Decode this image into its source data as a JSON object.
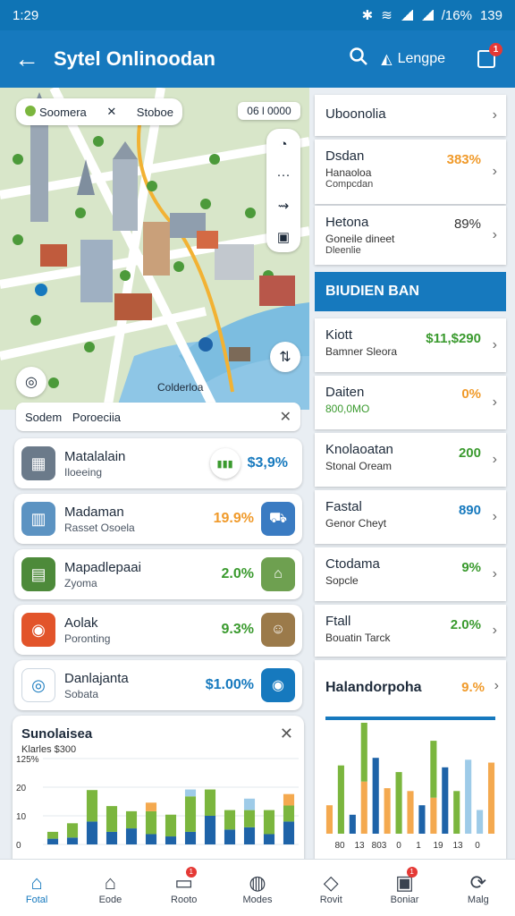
{
  "status_bar": {
    "time": "1:29",
    "battery": "139",
    "signal_text": "/16%"
  },
  "app_bar": {
    "title": "Sytel Onlinoodan",
    "language_label": "Lengpe",
    "cart_badge": "1"
  },
  "map": {
    "search_chip": {
      "left": "Soomera",
      "right": "Stoboe"
    },
    "code_chip": "06 l 0000",
    "area_label": "Colderloa"
  },
  "filter": {
    "label1": "Sodem",
    "label2": "Poroeciia"
  },
  "left_list": [
    {
      "title": "Matalalain",
      "subtitle": "Iloeeing",
      "value": "$3,9%",
      "value_color": "#1679be",
      "thumb_icon": "building-icon",
      "thumb_color": "#6b7a8a"
    },
    {
      "title": "Madaman",
      "subtitle": "Rasset Osoela",
      "value": "19.9%",
      "value_color": "#f09a2a",
      "thumb_icon": "city-icon",
      "thumb_color": "#5c93c2",
      "side_icon": "truck-icon",
      "side_color": "#3a7bc2"
    },
    {
      "title": "Mapadlepaai",
      "subtitle": "Zyoma",
      "value": "2.0%",
      "value_color": "#3a9a2e",
      "thumb_icon": "factory-icon",
      "thumb_color": "#4d8a3a",
      "side_icon": "bank-icon",
      "side_color": "#6ea050"
    },
    {
      "title": "Aolak",
      "subtitle": "Poronting",
      "value": "9.3%",
      "value_color": "#3a9a2e",
      "thumb_icon": "target-icon",
      "thumb_color": "#e2542a",
      "side_icon": "person-icon",
      "side_color": "#9b7a4a"
    },
    {
      "title": "Danlajanta",
      "subtitle": "Sobata",
      "value": "$1.00%",
      "value_color": "#1679be",
      "thumb_icon": "location-icon",
      "thumb_color": "#ffffff",
      "side_icon": "pin-icon",
      "side_color": "#1679be"
    }
  ],
  "left_chart_header": {
    "title": "Sunolaisea",
    "subtitle": "Klarles $300"
  },
  "chart_data": [
    {
      "type": "bar",
      "title": "Sunolaisea",
      "subtitle": "Klarles $300",
      "ytick_labels": [
        "125%",
        "20",
        "10",
        "0"
      ],
      "ylim": [
        0,
        150
      ],
      "grid": true,
      "series": [
        {
          "color": "#1e63a8",
          "values": [
            10,
            12,
            40,
            22,
            28,
            18,
            14,
            22,
            50,
            26,
            30,
            18,
            40
          ]
        },
        {
          "color": "#7bb63e",
          "values": [
            12,
            25,
            55,
            45,
            30,
            40,
            38,
            62,
            46,
            34,
            30,
            42,
            28
          ]
        },
        {
          "color": "#f4a94f",
          "values": [
            0,
            0,
            0,
            0,
            0,
            15,
            0,
            0,
            0,
            0,
            0,
            0,
            20
          ]
        },
        {
          "color": "#9ecbe8",
          "values": [
            0,
            0,
            0,
            0,
            0,
            0,
            0,
            12,
            0,
            0,
            20,
            0,
            0
          ]
        }
      ]
    },
    {
      "type": "bar",
      "title": "Halandorpoha",
      "xtick_labels": [
        "80",
        "13",
        "803",
        "0",
        "1",
        "19",
        "13",
        "0"
      ],
      "ylim": [
        0,
        100
      ],
      "grid": false,
      "series": [
        {
          "color": "#f4a94f",
          "values": [
            30,
            0,
            0,
            55,
            0,
            48,
            0,
            45,
            0,
            38,
            0,
            0,
            0,
            0,
            75
          ]
        },
        {
          "color": "#1e63a8",
          "values": [
            0,
            0,
            20,
            0,
            80,
            0,
            0,
            0,
            30,
            0,
            70,
            0,
            0,
            0,
            0
          ]
        },
        {
          "color": "#7bb63e",
          "values": [
            0,
            72,
            0,
            62,
            0,
            0,
            65,
            0,
            0,
            60,
            0,
            45,
            0,
            0,
            0
          ]
        },
        {
          "color": "#9ecbe8",
          "values": [
            0,
            0,
            0,
            0,
            0,
            0,
            0,
            0,
            0,
            0,
            0,
            0,
            78,
            25,
            0
          ]
        }
      ]
    }
  ],
  "right_top": [
    {
      "title": "Uboonolia",
      "subtitle": "",
      "subtitle2": "",
      "value": "",
      "value_color": "#333"
    },
    {
      "title": "Dsdan",
      "subtitle": "Hanaoloa",
      "subtitle2": "Compcdan",
      "value": "383%",
      "value_color": "#f09a2a"
    },
    {
      "title": "Hetona",
      "subtitle": "Goneile dineet",
      "subtitle2": "Dleenlie",
      "value": "89%",
      "value_color": "#333"
    }
  ],
  "right_banner": "BIUDIEN BAN",
  "right_list": [
    {
      "title": "Kiott",
      "subtitle": "Bamner Sleora",
      "value": "$11,$290",
      "value_color": "#3a9a2e"
    },
    {
      "title": "Daiten",
      "subtitle": "800,0MO",
      "value": "0%",
      "value_color": "#f09a2a",
      "subtitle_color": "#3a9a2e"
    },
    {
      "title": "Knolaoatan",
      "subtitle": "Stonal Oream",
      "value": "200",
      "value_color": "#3a9a2e"
    },
    {
      "title": "Fastal",
      "subtitle": "Genor Cheyt",
      "value": "890",
      "value_color": "#1679be"
    },
    {
      "title": "Ctodama",
      "subtitle": "Sopcle",
      "value": "9%",
      "value_color": "#3a9a2e"
    },
    {
      "title": "Ftall",
      "subtitle": "Bouatin Tarck",
      "value": "2.0%",
      "value_color": "#3a9a2e"
    }
  ],
  "right_chart_header": {
    "title": "Halandorpoha",
    "value": "9.%"
  },
  "nav": [
    {
      "label": "Fotal",
      "icon": "home-icon",
      "active": true
    },
    {
      "label": "Eode",
      "icon": "house-icon",
      "active": false
    },
    {
      "label": "Rooto",
      "icon": "inbox-icon",
      "active": false,
      "badge": "1"
    },
    {
      "label": "Modes",
      "icon": "chat-icon",
      "active": false
    },
    {
      "label": "Rovit",
      "icon": "share-icon",
      "active": false
    },
    {
      "label": "Boniar",
      "icon": "calendar-icon",
      "active": false,
      "badge": "1"
    },
    {
      "label": "Malg",
      "icon": "refresh-icon",
      "active": false
    }
  ]
}
